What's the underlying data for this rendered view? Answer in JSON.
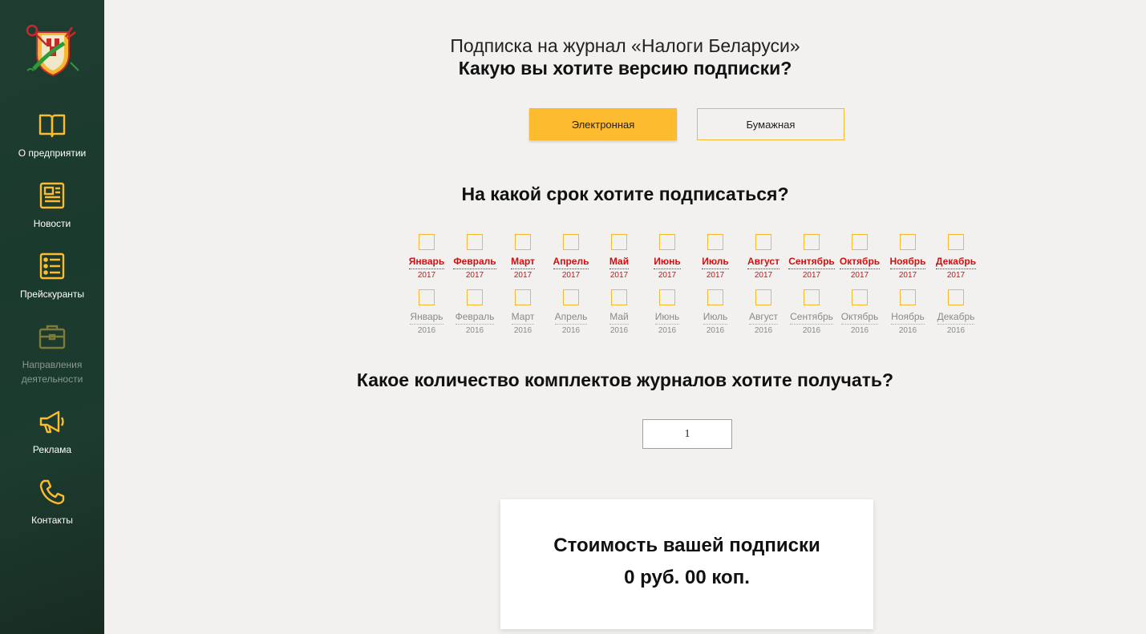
{
  "sidebar": {
    "logo_icon": "coat-of-arms-icon",
    "items": [
      {
        "label": "О предприятии",
        "icon": "book-icon"
      },
      {
        "label": "Новости",
        "icon": "newspaper-icon"
      },
      {
        "label": "Прейскуранты",
        "icon": "list-icon"
      },
      {
        "label": "Направления деятельности",
        "icon": "briefcase-icon"
      },
      {
        "label": "Реклама",
        "icon": "megaphone-icon"
      },
      {
        "label": "Контакты",
        "icon": "phone-icon"
      }
    ]
  },
  "header": {
    "subtitle": "Подписка на журнал «Налоги Беларуси»",
    "question_version": "Какую вы хотите версию подписки?"
  },
  "version_options": [
    "Электронная",
    "Бумажная"
  ],
  "selected_version": "Электронная",
  "period": {
    "question": "На какой срок хотите подписаться?",
    "months": [
      "Январь",
      "Февраль",
      "Март",
      "Апрель",
      "Май",
      "Июнь",
      "Июль",
      "Август",
      "Сентябрь",
      "Октябрь",
      "Ноябрь",
      "Декабрь"
    ],
    "years": [
      "2017",
      "2016"
    ]
  },
  "quantity": {
    "question": "Какое количество комплектов журналов хотите получать?",
    "value": "1"
  },
  "cost": {
    "title": "Стоимость вашей подписки",
    "value": "0 руб. 00 коп."
  },
  "colors": {
    "accent": "#fdbb30",
    "sidebar_bg": "#1d3b2f",
    "active_month": "#d10f0f",
    "inactive_month": "#8a8a8a"
  }
}
